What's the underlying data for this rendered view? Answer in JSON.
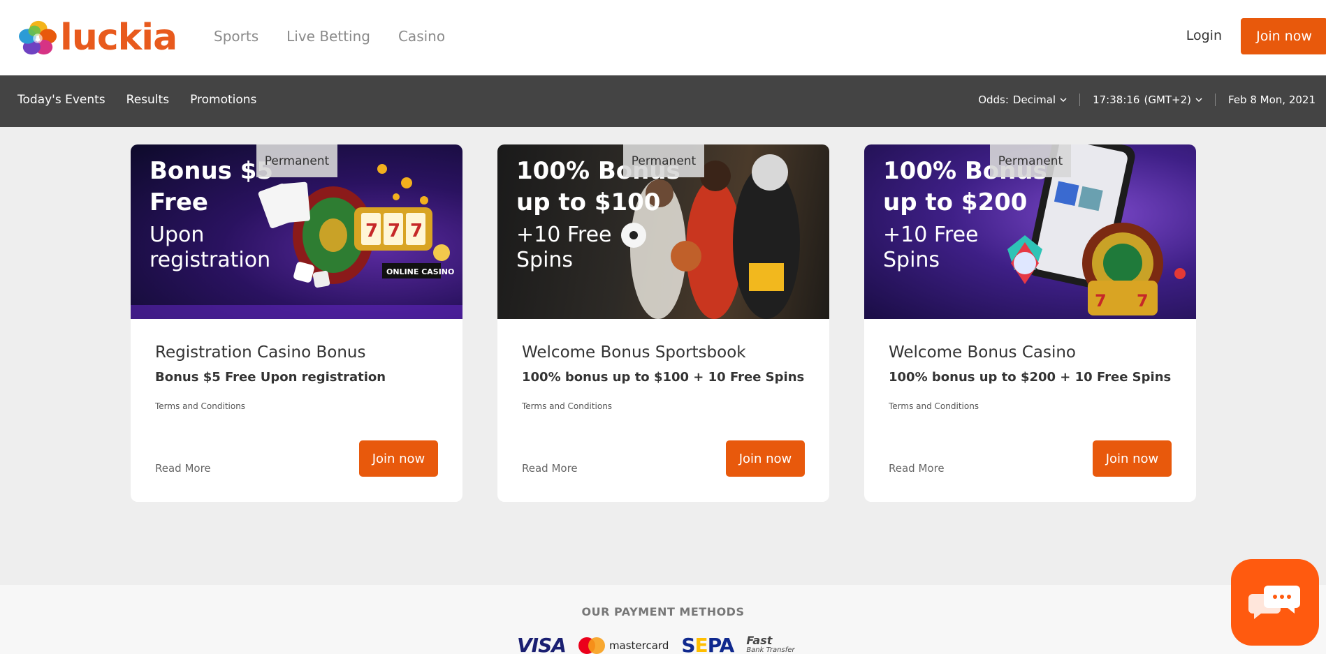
{
  "header": {
    "logo_text": "luckia",
    "nav": [
      "Sports",
      "Live Betting",
      "Casino"
    ],
    "login_label": "Login",
    "join_label": "Join now"
  },
  "subnav": {
    "links": [
      "Today's Events",
      "Results",
      "Promotions"
    ],
    "odds_label": "Odds:",
    "odds_value": "Decimal",
    "time": "17:38:16",
    "timezone": "(GMT+2)",
    "date": "Feb 8 Mon, 2021"
  },
  "cards": [
    {
      "badge": "Permanent",
      "banner_head": "Bonus $5\nFree",
      "banner_sub": "Upon\nregistration",
      "title": "Registration Casino Bonus",
      "description": "Bonus $5 Free Upon registration",
      "terms": "Terms and Conditions",
      "read_more": "Read More",
      "join": "Join now"
    },
    {
      "badge": "Permanent",
      "banner_head": "100% Bonus\nup to $100",
      "banner_sub": "+10 Free\nSpins",
      "title": "Welcome Bonus Sportsbook",
      "description": "100% bonus up to $100 + 10 Free Spins",
      "terms": "Terms and Conditions",
      "read_more": "Read More",
      "join": "Join now"
    },
    {
      "badge": "Permanent",
      "banner_head": "100% Bonus\nup to $200",
      "banner_sub": "+10 Free\nSpins",
      "title": "Welcome Bonus Casino",
      "description": "100% bonus up to $200 + 10 Free Spins",
      "terms": "Terms and Conditions",
      "read_more": "Read More",
      "join": "Join now"
    }
  ],
  "payments": {
    "title": "OUR PAYMENT METHODS",
    "methods": [
      "VISA",
      "mastercard",
      "SEPA",
      "Fast",
      "Bank Transfer"
    ]
  },
  "colors": {
    "accent": "#e8590c",
    "subnav_bg": "#444444",
    "page_bg": "#eeeeee",
    "chat": "#ff5a0f"
  },
  "icons": [
    "luckia-flower-logo",
    "chevron-down-icon",
    "chat-icon"
  ]
}
